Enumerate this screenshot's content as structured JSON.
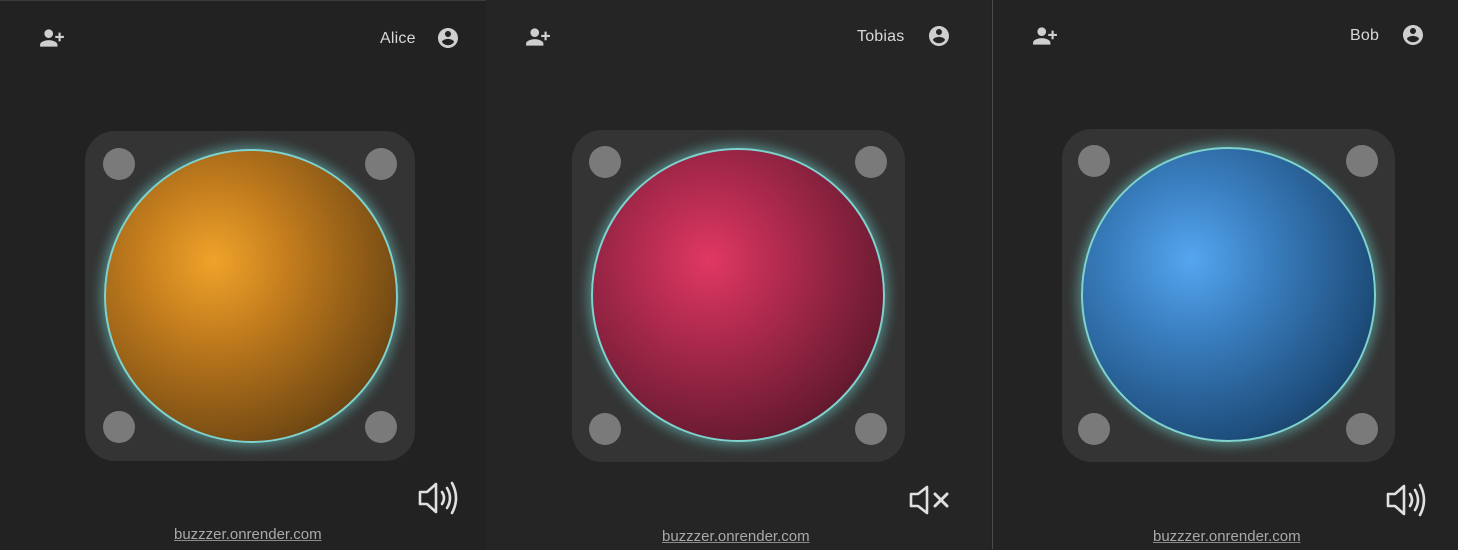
{
  "panels": [
    {
      "name": "Alice",
      "buzzer_color": "#e89a28",
      "buzzer_gradient": [
        "#f0a32a",
        "#c27c1d",
        "#7a4e14",
        "#3a260b"
      ],
      "sound": "on",
      "footer": "buzzzer.onrender.com",
      "icons": {
        "add_user": "person-add-icon",
        "profile": "account-circle-icon",
        "sound": "volume-up-icon"
      }
    },
    {
      "name": "Tobias",
      "buzzer_color": "#d8325e",
      "buzzer_gradient": [
        "#e03862",
        "#b02a4f",
        "#6e1c33",
        "#361018"
      ],
      "sound": "muted",
      "footer": "buzzzer.onrender.com",
      "icons": {
        "add_user": "person-add-icon",
        "profile": "account-circle-icon",
        "sound": "volume-off-icon"
      }
    },
    {
      "name": "Bob",
      "buzzer_color": "#4a9ee8",
      "buzzer_gradient": [
        "#55a6f0",
        "#3a7fc0",
        "#1f4f7e",
        "#0a2238"
      ],
      "sound": "on",
      "footer": "buzzzer.onrender.com",
      "icons": {
        "add_user": "person-add-icon",
        "profile": "account-circle-icon",
        "sound": "volume-up-icon"
      }
    }
  ]
}
